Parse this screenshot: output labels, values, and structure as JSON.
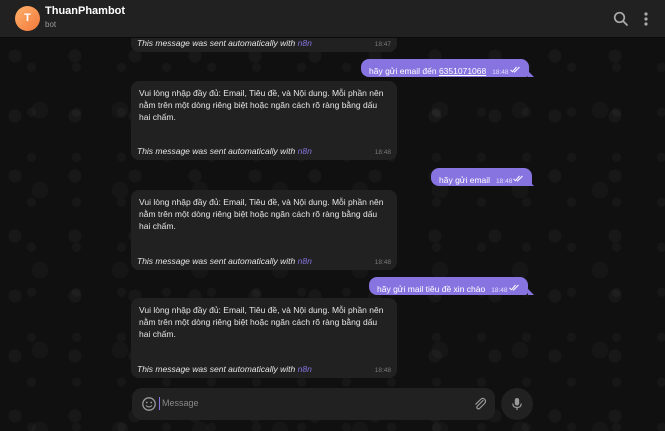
{
  "header": {
    "avatar_letter": "T",
    "title": "ThuanPhambot",
    "subtitle": "bot",
    "search_icon": "search-icon",
    "menu_icon": "more-vertical-icon"
  },
  "footer_label": "This message was sent automatically with",
  "footer_brand": "n8n",
  "messages": [
    {
      "dir": "in",
      "text": "",
      "time": "18:47"
    },
    {
      "dir": "out",
      "text": "hãy gửi email đến ",
      "link": "6351071068",
      "time": "18:48"
    },
    {
      "dir": "in",
      "text": "Vui lòng nhập đầy đủ: Email, Tiêu đề, và Nội dung. Mỗi phần nên nằm trên một dòng riêng biệt hoặc ngăn cách rõ ràng bằng dấu hai chấm.",
      "time": "18:48"
    },
    {
      "dir": "out",
      "text": "hãy gửi email",
      "time": "18:48"
    },
    {
      "dir": "in",
      "text": "Vui lòng nhập đầy đủ: Email, Tiêu đề, và Nội dung. Mỗi phần nên nằm trên một dòng riêng biệt hoặc ngăn cách rõ ràng bằng dấu hai chấm.",
      "time": "18:48"
    },
    {
      "dir": "out",
      "text": "hãy gửi mail tiêu đề xin chào",
      "time": "18:48"
    },
    {
      "dir": "in",
      "text": "Vui lòng nhập đầy đủ: Email, Tiêu đề, và Nội dung. Mỗi phần nên nằm trên một dòng riêng biệt hoặc ngăn cách rõ ràng bằng dấu hai chấm.",
      "time": "18:48"
    }
  ],
  "composer": {
    "placeholder": "Message",
    "emoji_icon": "smile-icon",
    "attach_icon": "paperclip-icon",
    "mic_icon": "microphone-icon"
  },
  "colors": {
    "accent": "#8774e1",
    "bubble_in": "#212121",
    "background": "#0f0f0f"
  }
}
